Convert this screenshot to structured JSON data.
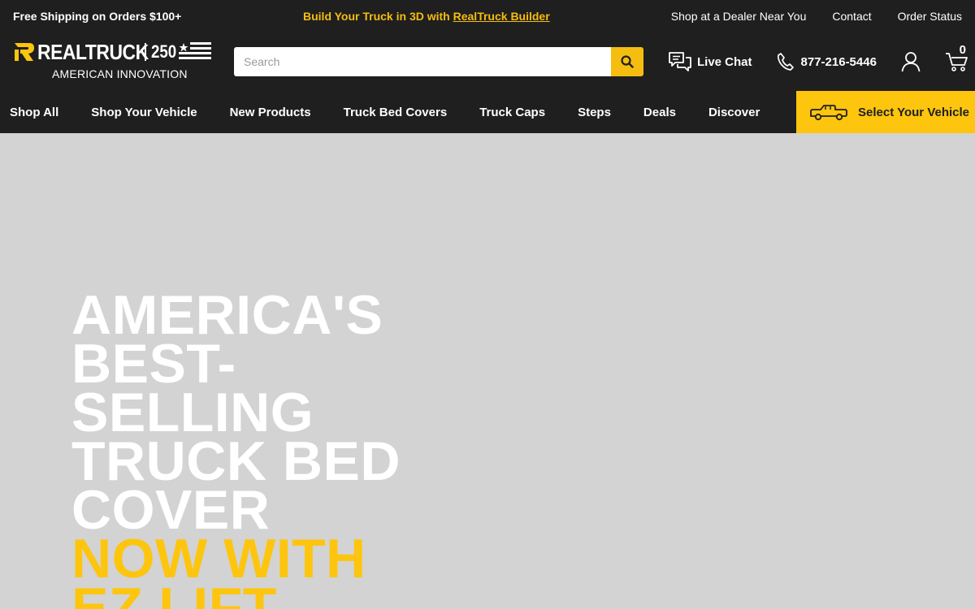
{
  "promo": {
    "left": "Free Shipping on Orders $100+",
    "center_prefix": "Build Your Truck in 3D with ",
    "center_link": "RealTruck Builder",
    "right_links": [
      "Shop at a Dealer Near You",
      "Contact",
      "Order Status"
    ]
  },
  "brand": {
    "name": "REALTRUCK",
    "badge": "250",
    "tagline": "AMERICAN INNOVATION",
    "accent_color": "#fdc50d",
    "dark_color": "#1f1f1f"
  },
  "search": {
    "placeholder": "Search",
    "button_icon": "search-icon"
  },
  "header_actions": {
    "live_chat_label": "Live Chat",
    "phone_number": "877-216-5446",
    "account_icon": "user-icon",
    "cart_icon": "cart-icon",
    "cart_count": "0"
  },
  "nav": {
    "items": [
      "Shop All",
      "Shop Your Vehicle",
      "New Products",
      "Truck Bed Covers",
      "Truck Caps",
      "Steps",
      "Deals",
      "Discover"
    ],
    "select_vehicle_label": "Select Your Vehicle"
  },
  "hero": {
    "headline_lines": [
      "AMERICA'S",
      "BEST-",
      "SELLING",
      "TRUCK BED",
      "COVER"
    ],
    "accent_lines": [
      "NOW WITH",
      "EZ LIFT"
    ]
  }
}
